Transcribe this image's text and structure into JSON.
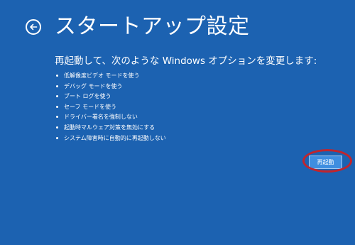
{
  "page": {
    "title": "スタートアップ設定",
    "subtitle": "再起動して、次のような Windows オプションを変更します:"
  },
  "options": [
    "低解像度ビデオ モードを使う",
    "デバッグ モードを使う",
    "ブート ログを使う",
    "セーフ モードを使う",
    "ドライバー署名を強制しない",
    "起動時マルウェア対策を無効にする",
    "システム障害時に自動的に再起動しない"
  ],
  "actions": {
    "restart_label": "再起動"
  },
  "colors": {
    "background": "#1c62b1",
    "text": "#ffffff",
    "button": "#3f8ee0",
    "highlight_ring": "#c0252d"
  },
  "icons": {
    "back": "back-arrow-circle-icon"
  }
}
